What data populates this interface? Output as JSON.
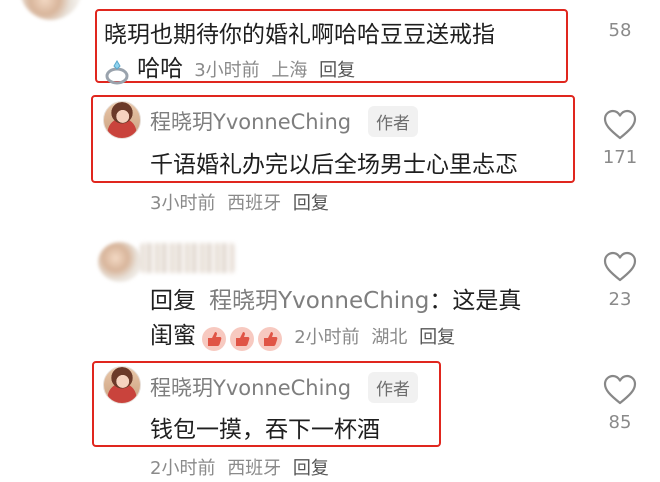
{
  "comments": [
    {
      "text_line1": "晓玥也期待你的婚礼啊哈哈豆豆送戒指",
      "text_line2": "哈哈",
      "time": "3小时前",
      "location": "上海",
      "reply": "回复",
      "likes": "58",
      "emoji_icon": "ring-icon"
    },
    {
      "username": "程晓玥YvonneChing",
      "badge": "作者",
      "text": "千语婚礼办完以后全场男士心里忐忑",
      "time": "3小时前",
      "location": "西班牙",
      "reply": "回复",
      "likes": "171"
    },
    {
      "reply_prefix": "回复",
      "reply_to": "程晓玥YvonneChing",
      "text_line1_tail": "：这是真",
      "text_line2": "闺蜜",
      "emoji_icon": "thumbs-up-icon",
      "emoji_count": 3,
      "time": "2小时前",
      "location": "湖北",
      "reply": "回复",
      "likes": "23"
    },
    {
      "username": "程晓玥YvonneChing",
      "badge": "作者",
      "text": "钱包一摸，吞下一杯酒",
      "time": "2小时前",
      "location": "西班牙",
      "reply": "回复",
      "likes": "85"
    }
  ],
  "colors": {
    "highlight": "#e0261e",
    "meta": "#8a8a8a"
  }
}
